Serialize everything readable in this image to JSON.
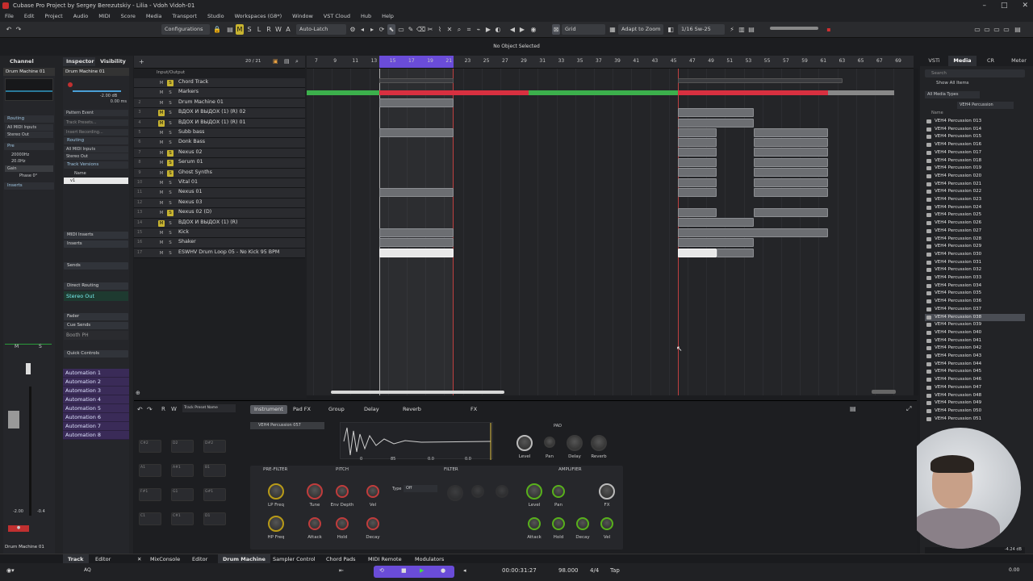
{
  "title": "Cubase Pro Project by Sergey Berezutskiy - Lilia - Vdoh Vidoh-01",
  "menu": [
    "File",
    "Edit",
    "Project",
    "Audio",
    "MIDI",
    "Score",
    "Media",
    "Transport",
    "Studio",
    "Workspaces (G8*)",
    "Window",
    "VST Cloud",
    "Hub",
    "Help"
  ],
  "toolbar": {
    "configurations": "Configurations",
    "automation": "Auto-Latch",
    "snap": "Grid",
    "zoom": "Adapt to Zoom",
    "quantize": "1/16 Sw-25"
  },
  "status_text": "No Object Selected",
  "left_tabs": {
    "channel": "Channel",
    "inspector": "Inspector",
    "visibility": "Visibility"
  },
  "channel": {
    "name": "Drum Machine 01",
    "routing": "Routing",
    "input": "All MIDI Inputs",
    "output": "Stereo Out",
    "pre": "Pre",
    "freq1": "20000Hz",
    "freq2": "20.0Hz",
    "gain": "Gain",
    "phase": "Phase 0°",
    "inserts": "Inserts",
    "vol_left": "-2.00",
    "vol_right": "-0.4",
    "bottom_name": "Drum Machine 01"
  },
  "inspector": {
    "track_name": "Drum Machine 01",
    "volume": "-2.00 dB",
    "pan": "0.00 ms",
    "pattern_event": "Pattern Event",
    "track_presets": "Track Presets...",
    "insert_recording": "Insert Recording...",
    "routing": "Routing",
    "input": "All MIDI Inputs",
    "output": "Stereo Out",
    "track_versions": "Track Versions",
    "version_col": "Name",
    "version_name": "v1",
    "midi_inserts": "MIDI Inserts",
    "inserts": "Inserts",
    "sends": "Sends",
    "direct_routing": "Direct Routing",
    "direct_out": "Stereo Out",
    "fader": "Fader",
    "cue_sends": "Cue Sends",
    "booth": "Booth PH",
    "quick_controls": "Quick Controls",
    "automations": [
      "Automation 1",
      "Automation 2",
      "Automation 3",
      "Automation 4",
      "Automation 5",
      "Automation 6",
      "Automation 7",
      "Automation 8"
    ]
  },
  "tracklist_header": {
    "label": "Input/Output",
    "count": "20 / 21"
  },
  "tracks": [
    {
      "num": "",
      "name": "Chord Track",
      "mute": false,
      "solo": true
    },
    {
      "num": "",
      "name": "Markers",
      "mute": false,
      "solo": false
    },
    {
      "num": "2",
      "name": "Drum Machine 01",
      "mute": false,
      "solo": false
    },
    {
      "num": "3",
      "name": "ВДОХ И ВЫДОХ (1) (R) 02",
      "mute": true,
      "solo": false
    },
    {
      "num": "4",
      "name": "ВДОХ И ВЫДОХ (1) (R) 01",
      "mute": true,
      "solo": false
    },
    {
      "num": "5",
      "name": "Subb bass",
      "mute": false,
      "solo": false
    },
    {
      "num": "6",
      "name": "Donk Bass",
      "mute": false,
      "solo": false
    },
    {
      "num": "7",
      "name": "Nexus 02",
      "mute": false,
      "solo": true
    },
    {
      "num": "8",
      "name": "Serum 01",
      "mute": false,
      "solo": true
    },
    {
      "num": "9",
      "name": "Ghost Synths",
      "mute": false,
      "solo": true
    },
    {
      "num": "10",
      "name": "Vital 01",
      "mute": false,
      "solo": false
    },
    {
      "num": "11",
      "name": "Nexus 01",
      "mute": false,
      "solo": false
    },
    {
      "num": "12",
      "name": "Nexus 03",
      "mute": false,
      "solo": false
    },
    {
      "num": "13",
      "name": "Nexus 02 (D)",
      "mute": false,
      "solo": true
    },
    {
      "num": "14",
      "name": "ВДОХ И ВЫДОХ (1) (R)",
      "mute": true,
      "solo": false
    },
    {
      "num": "15",
      "name": "Kick",
      "mute": false,
      "solo": false
    },
    {
      "num": "16",
      "name": "Shaker",
      "mute": false,
      "solo": false
    },
    {
      "num": "17",
      "name": "ESWHV Drum Loop 05 - No Kick 95 BPM",
      "mute": false,
      "solo": false
    }
  ],
  "ruler": [
    "7",
    "9",
    "11",
    "13",
    "15",
    "17",
    "19",
    "21",
    "23",
    "25",
    "27",
    "29",
    "31",
    "33",
    "35",
    "37",
    "39",
    "41",
    "43",
    "45",
    "47",
    "49",
    "51",
    "53",
    "55",
    "57",
    "59",
    "61",
    "63",
    "65",
    "67",
    "69"
  ],
  "media": {
    "tabs": [
      "VSTi",
      "Media",
      "CR",
      "Meter"
    ],
    "search": "Search",
    "show_all": "Show All Items",
    "filter_type": "All Media Types",
    "filter_path": "VEH4 Percussion",
    "col_name": "Name",
    "items": [
      "VEH4 Percussion 013",
      "VEH4 Percussion 014",
      "VEH4 Percussion 015",
      "VEH4 Percussion 016",
      "VEH4 Percussion 017",
      "VEH4 Percussion 018",
      "VEH4 Percussion 019",
      "VEH4 Percussion 020",
      "VEH4 Percussion 021",
      "VEH4 Percussion 022",
      "VEH4 Percussion 023",
      "VEH4 Percussion 024",
      "VEH4 Percussion 025",
      "VEH4 Percussion 026",
      "VEH4 Percussion 027",
      "VEH4 Percussion 028",
      "VEH4 Percussion 029",
      "VEH4 Percussion 030",
      "VEH4 Percussion 031",
      "VEH4 Percussion 032",
      "VEH4 Percussion 033",
      "VEH4 Percussion 034",
      "VEH4 Percussion 035",
      "VEH4 Percussion 036",
      "VEH4 Percussion 037",
      "VEH4 Percussion 038",
      "VEH4 Percussion 039",
      "VEH4 Percussion 040",
      "VEH4 Percussion 041",
      "VEH4 Percussion 042",
      "VEH4 Percussion 043",
      "VEH4 Percussion 044",
      "VEH4 Percussion 045",
      "VEH4 Percussion 046",
      "VEH4 Percussion 047",
      "VEH4 Percussion 048",
      "VEH4 Percussion 049",
      "VEH4 Percussion 050",
      "VEH4 Percussion 051"
    ],
    "selected": "VEH4 Percussion 038",
    "volume": "-4.24 dB"
  },
  "lower": {
    "preset": "Track Preset Name",
    "tabs": [
      "Instrument",
      "Pad FX",
      "Group",
      "Delay",
      "Reverb",
      "FX"
    ],
    "sample_name": "VEH4 Percussion 057",
    "pad": "PAD",
    "pad_knobs": [
      "Level",
      "Pan",
      "Delay",
      "Reverb"
    ],
    "wave_vals": [
      "0",
      "85",
      "0.0",
      "0.0"
    ],
    "sections": [
      "PRE-FILTER",
      "PITCH",
      "FILTER",
      "AMPLIFIER"
    ],
    "prefilter": [
      "LP Freq",
      "HP Freq"
    ],
    "pitch": [
      "Tune",
      "Env Depth",
      "Vel",
      "Attack",
      "Hold",
      "Decay"
    ],
    "filter_type_label": "Type",
    "filter_type": "Off",
    "amp": [
      "Level",
      "Pan",
      "FX",
      "Attack",
      "Hold",
      "Decay",
      "Vel"
    ],
    "pad_labels": [
      "C#2",
      "D2",
      "D#2",
      "A1",
      "A#1",
      "B1",
      "F#1",
      "G1",
      "G#1",
      "C1",
      "C#1",
      "D1"
    ]
  },
  "bottom_tabs": {
    "left": [
      "Track",
      "Editor"
    ],
    "main": [
      "MixConsole",
      "Editor",
      "Drum Machine",
      "Sampler Control",
      "Chord Pads",
      "MIDI Remote",
      "Modulators"
    ]
  },
  "transport": {
    "time": "00:00:31:27",
    "tempo": "98.000",
    "signature": "4/4",
    "tap": "Tap",
    "ax": "AQ",
    "level": "0.00"
  }
}
